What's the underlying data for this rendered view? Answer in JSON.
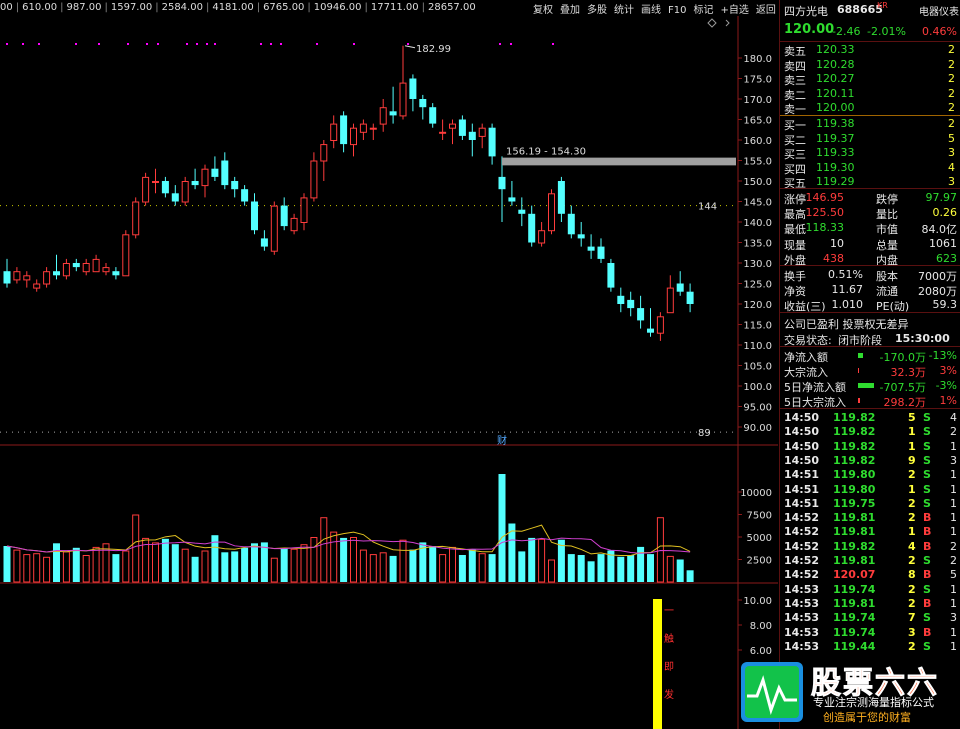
{
  "ma_values": [
    "00",
    "610.00",
    "987.00",
    "1597.00",
    "2584.00",
    "4181.00",
    "6765.00",
    "10946.00",
    "17711.00",
    "28657.00"
  ],
  "toolbar": [
    "复权",
    "叠加",
    "多股",
    "统计",
    "画线",
    "F10",
    "标记",
    "+自选",
    "返回"
  ],
  "price_axis": [
    "180.0",
    "175.0",
    "170.0",
    "165.0",
    "160.0",
    "155.0",
    "150.0",
    "145.0",
    "140.0",
    "135.0",
    "130.0",
    "125.0",
    "120.0",
    "115.0",
    "110.0",
    "105.0",
    "100.0",
    "95.00",
    "90.00"
  ],
  "vol_axis": [
    "10000",
    "7500",
    "5000",
    "2500"
  ],
  "ind_axis": [
    "10.00",
    "8.00",
    "6.00"
  ],
  "chart_labels": {
    "high": "182.99",
    "range": "156.19 - 154.30",
    "level_144": "144",
    "level_89": "89",
    "cai": "财"
  },
  "indicator_text": [
    "一",
    "触",
    "即",
    "发"
  ],
  "stock": {
    "name": "四方光电",
    "code": "688665",
    "tag": "KR",
    "sector": "电器仪表",
    "price": "120.00",
    "change": "-2.46",
    "pct": "-2.01%",
    "turnover_badge": "0.46%"
  },
  "asks": [
    {
      "label": "卖五",
      "price": "120.33",
      "vol": "2"
    },
    {
      "label": "卖四",
      "price": "120.28",
      "vol": "2"
    },
    {
      "label": "卖三",
      "price": "120.27",
      "vol": "2"
    },
    {
      "label": "卖二",
      "price": "120.11",
      "vol": "2"
    },
    {
      "label": "卖一",
      "price": "120.00",
      "vol": "2"
    }
  ],
  "bids": [
    {
      "label": "买一",
      "price": "119.38",
      "vol": "2"
    },
    {
      "label": "买二",
      "price": "119.37",
      "vol": "5"
    },
    {
      "label": "买三",
      "price": "119.33",
      "vol": "3"
    },
    {
      "label": "买四",
      "price": "119.30",
      "vol": "4"
    },
    {
      "label": "买五",
      "price": "119.29",
      "vol": "3"
    }
  ],
  "stats": [
    {
      "l1": "涨停",
      "v1": "146.95",
      "c1": "red",
      "l2": "跌停",
      "v2": "97.97",
      "c2": "grn"
    },
    {
      "l1": "最高",
      "v1": "125.50",
      "c1": "red",
      "l2": "量比",
      "v2": "0.26",
      "c2": "yel"
    },
    {
      "l1": "最低",
      "v1": "118.33",
      "c1": "grn",
      "l2": "市值",
      "v2": "84.0亿",
      "c2": "wht"
    },
    {
      "l1": "现量",
      "v1": "10",
      "c1": "wht",
      "l2": "总量",
      "v2": "1061",
      "c2": "wht"
    },
    {
      "l1": "外盘",
      "v1": "438",
      "c1": "red",
      "l2": "内盘",
      "v2": "623",
      "c2": "grn"
    }
  ],
  "stats2": [
    {
      "l1": "换手",
      "v1": "0.51%",
      "c1": "wht",
      "l2": "股本",
      "v2": "7000万",
      "c2": "wht"
    },
    {
      "l1": "净资",
      "v1": "11.67",
      "c1": "wht",
      "l2": "流通",
      "v2": "2080万",
      "c2": "wht"
    },
    {
      "l1": "收益(三)",
      "v1": "1.010",
      "c1": "wht",
      "l2": "PE(动)",
      "v2": "59.3",
      "c2": "wht"
    }
  ],
  "company_info": "公司已盈利 投票权无差异",
  "trade_status_label": "交易状态:",
  "trade_status_value": "闭市阶段",
  "trade_status_time": "15:30:00",
  "flows": [
    {
      "label": "净流入额",
      "value": "-170.0万",
      "pct": "-13%",
      "color": "grn",
      "bar": 0.3
    },
    {
      "label": "大宗流入",
      "value": "32.3万",
      "pct": "3%",
      "color": "red",
      "bar": 0.05
    },
    {
      "label": "5日净流入额",
      "value": "-707.5万",
      "pct": "-3%",
      "color": "grn",
      "bar": 1.0
    },
    {
      "label": "5日大宗流入",
      "value": "298.2万",
      "pct": "1%",
      "color": "red",
      "bar": 0.1
    }
  ],
  "ticks": [
    {
      "t": "14:50",
      "p": "119.82",
      "v": "5",
      "s": "S",
      "n": "4"
    },
    {
      "t": "14:50",
      "p": "119.82",
      "v": "1",
      "s": "S",
      "n": "2"
    },
    {
      "t": "14:50",
      "p": "119.82",
      "v": "1",
      "s": "S",
      "n": "1"
    },
    {
      "t": "14:50",
      "p": "119.82",
      "v": "9",
      "s": "S",
      "n": "3"
    },
    {
      "t": "14:51",
      "p": "119.80",
      "v": "2",
      "s": "S",
      "n": "1"
    },
    {
      "t": "14:51",
      "p": "119.80",
      "v": "1",
      "s": "S",
      "n": "1"
    },
    {
      "t": "14:51",
      "p": "119.75",
      "v": "2",
      "s": "S",
      "n": "1"
    },
    {
      "t": "14:52",
      "p": "119.81",
      "v": "2",
      "s": "B",
      "n": "1"
    },
    {
      "t": "14:52",
      "p": "119.81",
      "v": "1",
      "s": "B",
      "n": "1"
    },
    {
      "t": "14:52",
      "p": "119.82",
      "v": "4",
      "s": "B",
      "n": "2"
    },
    {
      "t": "14:52",
      "p": "119.81",
      "v": "2",
      "s": "S",
      "n": "2"
    },
    {
      "t": "14:52",
      "p": "120.07",
      "v": "8",
      "s": "B",
      "n": "5"
    },
    {
      "t": "14:53",
      "p": "119.74",
      "v": "2",
      "s": "S",
      "n": "1"
    },
    {
      "t": "14:53",
      "p": "119.81",
      "v": "2",
      "s": "B",
      "n": "1"
    },
    {
      "t": "14:53",
      "p": "119.74",
      "v": "7",
      "s": "S",
      "n": "3"
    },
    {
      "t": "14:53",
      "p": "119.74",
      "v": "3",
      "s": "B",
      "n": "1"
    },
    {
      "t": "14:53",
      "p": "119.44",
      "v": "2",
      "s": "S",
      "n": "1"
    }
  ],
  "logo": {
    "title": "股票六六",
    "line1": "专业注宗测海量指标公式",
    "line2": "创造属于您的财富"
  },
  "colors": {
    "up": "#ff3c3c",
    "down": "#54ffff",
    "bg": "#000000",
    "grid": "#8b1a1a"
  },
  "chart_data": {
    "type": "candlestick",
    "candles": [
      [
        128,
        131,
        124,
        125
      ],
      [
        126,
        129,
        125,
        128
      ],
      [
        126,
        128,
        124,
        127
      ],
      [
        124,
        126,
        123,
        125
      ],
      [
        125,
        129,
        124,
        128
      ],
      [
        128,
        132,
        126,
        127
      ],
      [
        127,
        131,
        126,
        130
      ],
      [
        130,
        131,
        128,
        129
      ],
      [
        128,
        131,
        127,
        130
      ],
      [
        128,
        132,
        128,
        131
      ],
      [
        128,
        130,
        127,
        129
      ],
      [
        128,
        129,
        126,
        127
      ],
      [
        127,
        138,
        127,
        137
      ],
      [
        137,
        146,
        136,
        145
      ],
      [
        145,
        152,
        144,
        151
      ],
      [
        150,
        153,
        147,
        150
      ],
      [
        150,
        151,
        146,
        147
      ],
      [
        147,
        149,
        144,
        145
      ],
      [
        145,
        151,
        144,
        150
      ],
      [
        150,
        153,
        148,
        149
      ],
      [
        149,
        154,
        146,
        153
      ],
      [
        153,
        156,
        150,
        151
      ],
      [
        155,
        157,
        148,
        149
      ],
      [
        150,
        151,
        146,
        148
      ],
      [
        148,
        149,
        144,
        145
      ],
      [
        145,
        147,
        137,
        138
      ],
      [
        136,
        138,
        133,
        134
      ],
      [
        133,
        145,
        132,
        144
      ],
      [
        144,
        146,
        138,
        139
      ],
      [
        138,
        142,
        137,
        141
      ],
      [
        140,
        147,
        138,
        146
      ],
      [
        146,
        157,
        145,
        155
      ],
      [
        155,
        160,
        150,
        159
      ],
      [
        160,
        166,
        158,
        164
      ],
      [
        166,
        167,
        157,
        159
      ],
      [
        159,
        164,
        156,
        163
      ],
      [
        162,
        165,
        160,
        164
      ],
      [
        163,
        164,
        160,
        163
      ],
      [
        164,
        170,
        162,
        168
      ],
      [
        167,
        173,
        164,
        166
      ],
      [
        166,
        183,
        165,
        174
      ],
      [
        175,
        176,
        167,
        170
      ],
      [
        170,
        171,
        165,
        168
      ],
      [
        168,
        169,
        163,
        164
      ],
      [
        162,
        165,
        160,
        162
      ],
      [
        163,
        165,
        159,
        164
      ],
      [
        165,
        166,
        160,
        161
      ],
      [
        162,
        164,
        156,
        160
      ],
      [
        161,
        164,
        158,
        163
      ],
      [
        163,
        164,
        154,
        156
      ],
      [
        151,
        156,
        140,
        148
      ],
      [
        146,
        150,
        144,
        145
      ],
      [
        143,
        146,
        139,
        142
      ],
      [
        142,
        144,
        134,
        135
      ],
      [
        135,
        140,
        134,
        138
      ],
      [
        138,
        148,
        137,
        147
      ],
      [
        150,
        151,
        140,
        142
      ],
      [
        142,
        144,
        136,
        137
      ],
      [
        137,
        140,
        134,
        136
      ],
      [
        134,
        137,
        131,
        133
      ],
      [
        134,
        136,
        130,
        131
      ],
      [
        130,
        131,
        123,
        124
      ],
      [
        122,
        124,
        118,
        120
      ],
      [
        121,
        123,
        117,
        119
      ],
      [
        119,
        122,
        114,
        116
      ],
      [
        114,
        119,
        112,
        113
      ],
      [
        113,
        118,
        111,
        117
      ],
      [
        118,
        127,
        118,
        124
      ],
      [
        125,
        128,
        122,
        123
      ],
      [
        123,
        125,
        118,
        120
      ]
    ],
    "volume": [
      4000,
      3600,
      3100,
      3200,
      2800,
      4300,
      3400,
      3800,
      3000,
      3900,
      4300,
      3100,
      3500,
      7500,
      4900,
      4400,
      4800,
      4200,
      3700,
      2800,
      3500,
      5200,
      3300,
      3400,
      3800,
      4300,
      4400,
      2700,
      3700,
      3700,
      4200,
      5000,
      7200,
      5600,
      4900,
      5000,
      3600,
      3100,
      3300,
      2900,
      4700,
      3600,
      4400,
      4000,
      3100,
      3900,
      3000,
      3600,
      3200,
      3100,
      12000,
      6500,
      3400,
      4900,
      4800,
      2500,
      4700,
      3100,
      3000,
      2300,
      3100,
      3500,
      2800,
      3000,
      3900,
      3100,
      7200,
      2900,
      2500,
      1300
    ],
    "ylim": [
      88,
      185
    ],
    "vol_ylim": [
      0,
      12500
    ]
  }
}
